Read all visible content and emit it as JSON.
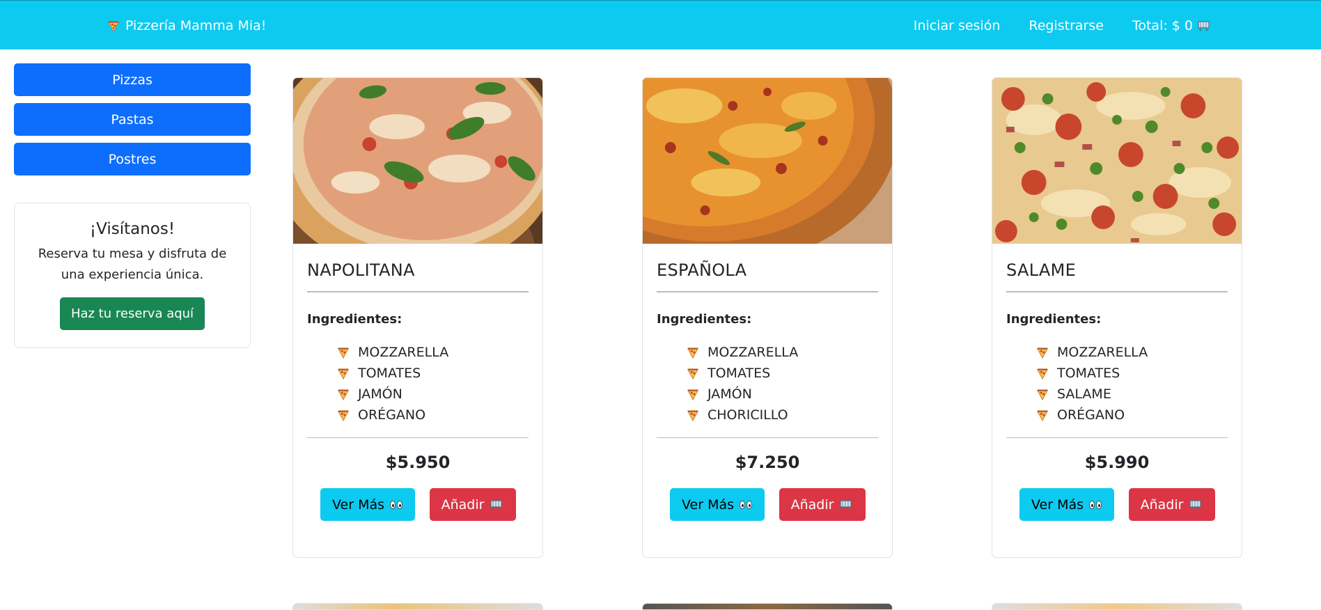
{
  "navbar": {
    "brand": "Pizzería Mamma Mia!",
    "brand_icon": "pizza-icon",
    "login": "Iniciar sesión",
    "register": "Registrarse",
    "total": "Total: $ 0",
    "total_icon": "cart-icon",
    "bg_color": "#0dcaf0"
  },
  "sidebar": {
    "categories": [
      "Pizzas",
      "Pastas",
      "Postres"
    ],
    "visit": {
      "title": "¡Visítanos!",
      "text": "Reserva tu mesa y disfruta de una experiencia única.",
      "button": "Haz tu reserva aquí"
    }
  },
  "pizzas": [
    {
      "name": "NAPOLITANA",
      "ingredients_label": "Ingredientes:",
      "ingredients": [
        "MOZZARELLA",
        "TOMATES",
        "JAMÓN",
        "ORÉGANO"
      ],
      "price": "$5.950",
      "more_label": "Ver Más",
      "add_label": "Añadir",
      "image": "pizza-napolitana-photo"
    },
    {
      "name": "ESPAÑOLA",
      "ingredients_label": "Ingredientes:",
      "ingredients": [
        "MOZZARELLA",
        "TOMATES",
        "JAMÓN",
        "CHORICILLO"
      ],
      "price": "$7.250",
      "more_label": "Ver Más",
      "add_label": "Añadir",
      "image": "pizza-espanola-photo"
    },
    {
      "name": "SALAME",
      "ingredients_label": "Ingredientes:",
      "ingredients": [
        "MOZZARELLA",
        "TOMATES",
        "SALAME",
        "ORÉGANO"
      ],
      "price": "$5.990",
      "more_label": "Ver Más",
      "add_label": "Añadir",
      "image": "pizza-salame-photo"
    }
  ],
  "colors": {
    "primary": "#0d6efd",
    "info": "#0dcaf0",
    "success": "#198754",
    "danger": "#dc3545"
  }
}
